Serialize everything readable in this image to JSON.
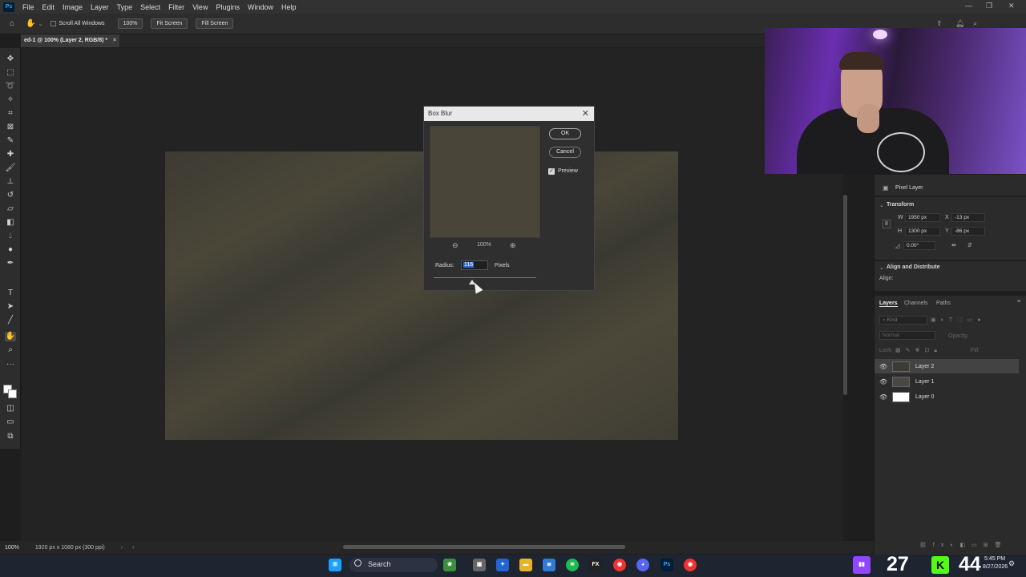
{
  "menubar": {
    "logo": "Ps",
    "items": [
      "File",
      "Edit",
      "Image",
      "Layer",
      "Type",
      "Select",
      "Filter",
      "View",
      "Plugins",
      "Window",
      "Help"
    ]
  },
  "options_bar": {
    "scroll_all_windows": "Scroll All Windows",
    "zoom_100": "100%",
    "fit_screen": "Fit Screen",
    "fill_screen": "Fill Screen"
  },
  "document_tab": {
    "title": "ed-1 @ 100% (Layer 2, RGB/8) *",
    "close": "×"
  },
  "dialog": {
    "title": "Box Blur",
    "close": "✕",
    "ok": "OK",
    "cancel": "Cancel",
    "preview_label": "Preview",
    "preview_checked": true,
    "zoom_out": "⊖",
    "zoom_level": "100%",
    "zoom_in": "⊕",
    "radius_label": "Radius:",
    "radius_value": "116",
    "radius_unit": "Pixels"
  },
  "properties_panel": {
    "type_label": "Pixel Layer",
    "transform_heading": "Transform",
    "w_label": "W",
    "w_value": "1950 px",
    "x_label": "X",
    "x_value": "-13 px",
    "h_label": "H",
    "h_value": "1300 px",
    "y_label": "Y",
    "y_value": "-86 px",
    "angle_value": "0.00°",
    "align_heading": "Align and Distribute",
    "align_label": "Align:"
  },
  "layers_panel": {
    "tabs": [
      "Layers",
      "Channels",
      "Paths"
    ],
    "kind_placeholder": "Kind",
    "blend_mode": "Normal",
    "opacity_label": "Opacity:",
    "lock_label": "Lock:",
    "fill_label": "Fill:",
    "layers": [
      {
        "name": "Layer 2",
        "selected": true,
        "thumb": "#3e3b33"
      },
      {
        "name": "Layer 1",
        "selected": false,
        "thumb": "#4a4744"
      },
      {
        "name": "Layer 0",
        "selected": false,
        "thumb": "#ffffff"
      }
    ]
  },
  "statusbar": {
    "zoom": "100%",
    "doc_info": "1920 px x 1080 px (300 ppi)"
  },
  "taskbar": {
    "search_label": "Search",
    "counter_left": "27",
    "counter_right": "44",
    "clock_time": "5:45 PM",
    "clock_date": "8/27/2026"
  }
}
